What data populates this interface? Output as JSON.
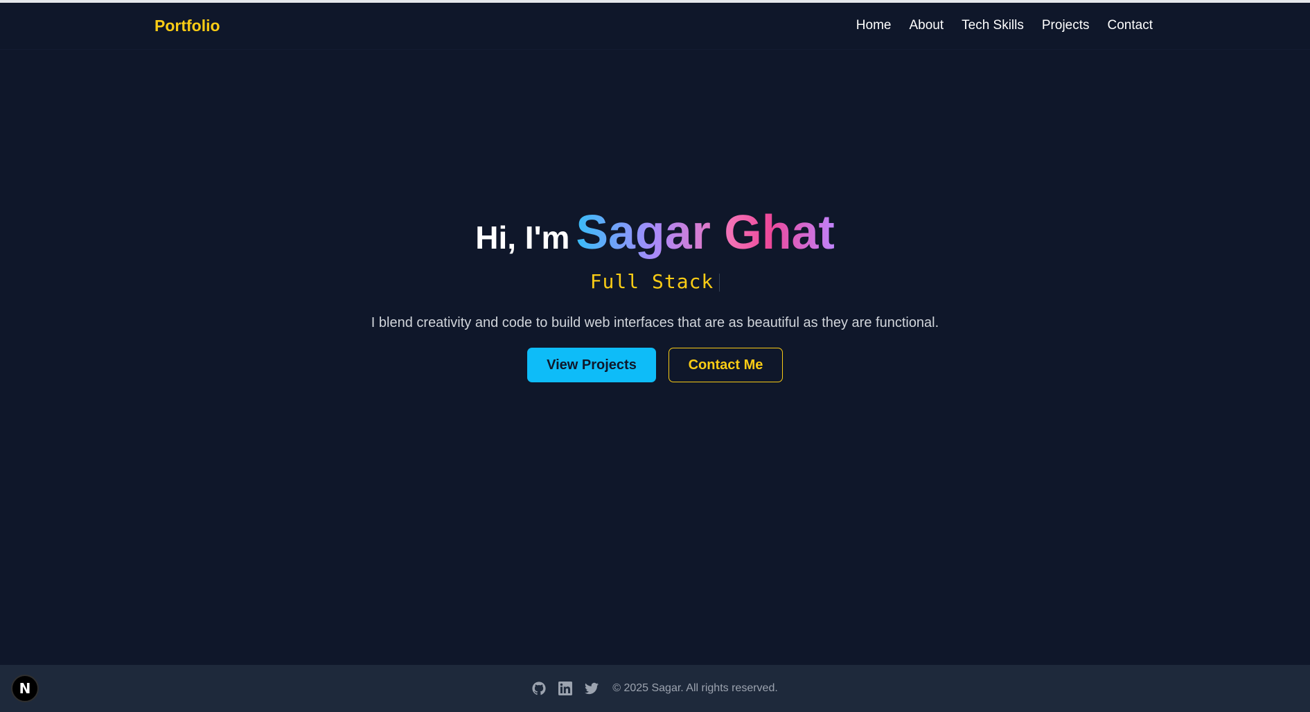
{
  "nav": {
    "brand": "Portfolio",
    "links": [
      "Home",
      "About",
      "Tech Skills",
      "Projects",
      "Contact"
    ]
  },
  "hero": {
    "greeting": "Hi, I'm",
    "name": "Sagar Ghat",
    "role": "Full Stack",
    "tagline": "I blend creativity and code to build web interfaces that are as beautiful as they are functional.",
    "primary_button": "View Projects",
    "secondary_button": "Contact Me"
  },
  "footer": {
    "icons": [
      "github-icon",
      "linkedin-icon",
      "twitter-icon"
    ],
    "copyright": "© 2025 Sagar. All rights reserved."
  },
  "dev_badge": {
    "letter": "N"
  },
  "colors": {
    "background": "#0f172a",
    "accent_yellow": "#facc15",
    "accent_cyan": "#0ebcf8",
    "footer_bg": "#1e293b"
  }
}
